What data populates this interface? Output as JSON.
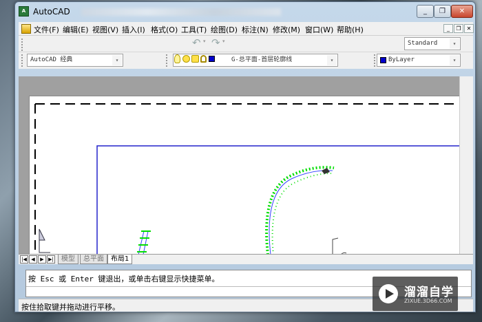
{
  "window": {
    "title": "AutoCAD",
    "app_icon_text": "A"
  },
  "window_buttons": {
    "minimize": "_",
    "restore": "❐",
    "close": "✕"
  },
  "menu": {
    "items": [
      "文件(F)",
      "编辑(E)",
      "视图(V)",
      "插入(I)",
      "格式(O)",
      "工具(T)",
      "绘图(D)",
      "标注(N)",
      "修改(M)",
      "窗口(W)",
      "帮助(H)"
    ],
    "mdi_buttons": [
      "_",
      "❐",
      "✕"
    ]
  },
  "toolbar": {
    "text_style": "Standard",
    "workspace": "AutoCAD 经典",
    "layer": "G-总平面-首层轮廓线",
    "color": "ByLayer",
    "undo_icon": "undo-icon",
    "redo_icon": "redo-icon"
  },
  "tabs": {
    "nav": [
      "|◀",
      "◀",
      "▶",
      "▶|"
    ],
    "items": [
      "模型",
      "总平面",
      "布局1"
    ],
    "active": "布局1"
  },
  "command": {
    "prompt": "按 Esc 或 Enter 键退出，或单击右键显示快捷菜单。"
  },
  "status": {
    "text": "按住拾取键并拖动进行平移。"
  },
  "watermark": {
    "title": "溜溜自学",
    "url": "ZIXUE.3D66.COM"
  },
  "colors": {
    "layer_blue": "#0000cc",
    "annotation_green": "#00dd00",
    "bylayer_swatch": "#0000cc"
  }
}
